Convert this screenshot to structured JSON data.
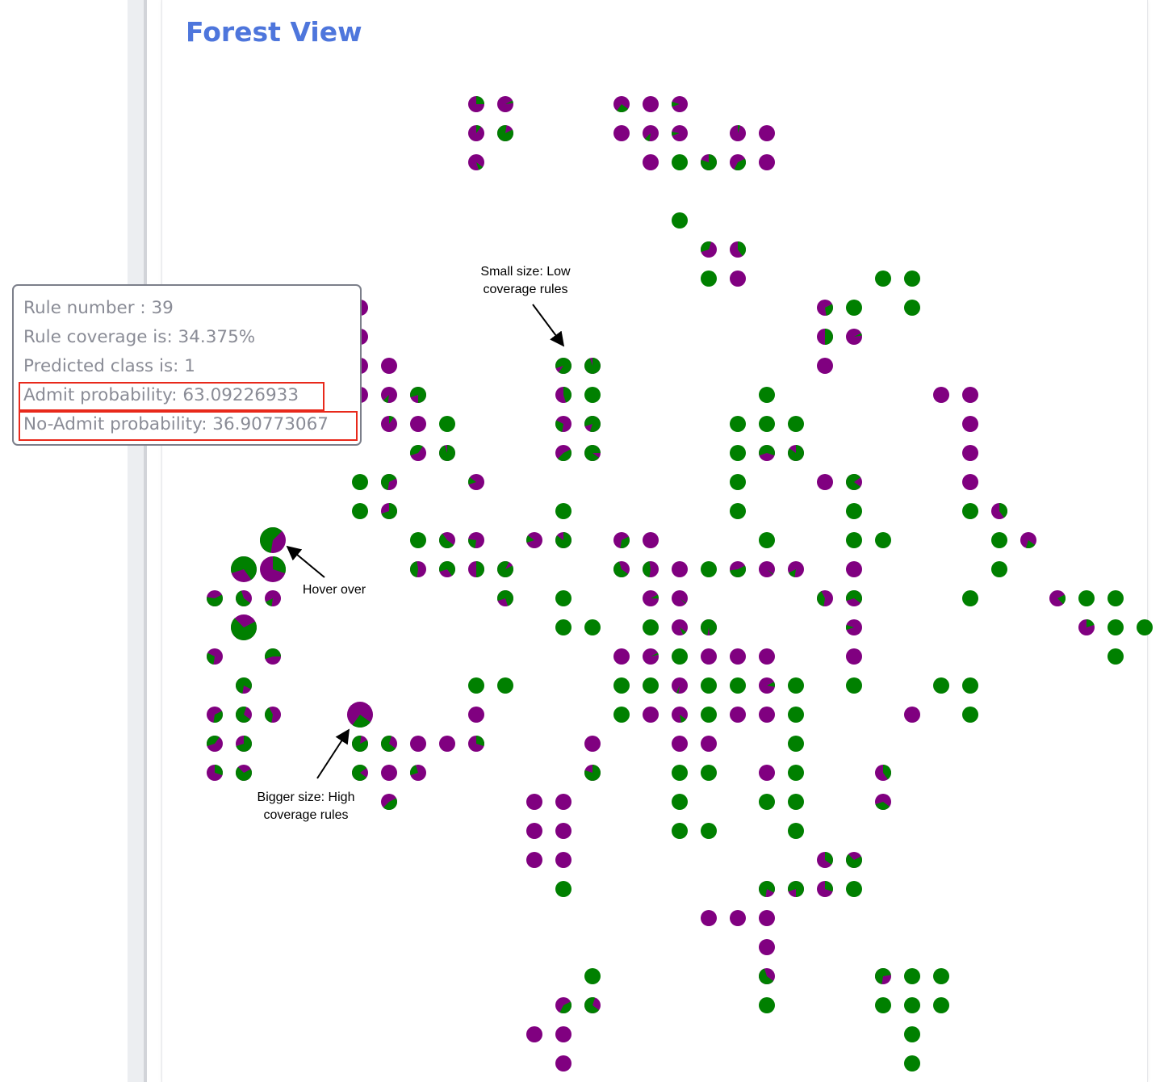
{
  "title": "Forest View",
  "colors": {
    "admit": "#008000",
    "no_admit": "#800080",
    "title": "#4e76dc",
    "highlight": "#e8291b"
  },
  "tooltip": {
    "rule_number": "Rule number : 39",
    "rule_coverage": "Rule coverage is: 34.375%",
    "predicted_class": "Predicted class is: 1",
    "admit_probability": "Admit probability: 63.09226933",
    "no_admit_probability": "No-Admit probability: 36.90773067"
  },
  "annotations": {
    "small_size": [
      "Small size: Low",
      "coverage rules"
    ],
    "hover": "Hover over",
    "bigger_size": [
      "Bigger size: High",
      "coverage rules"
    ]
  }
}
